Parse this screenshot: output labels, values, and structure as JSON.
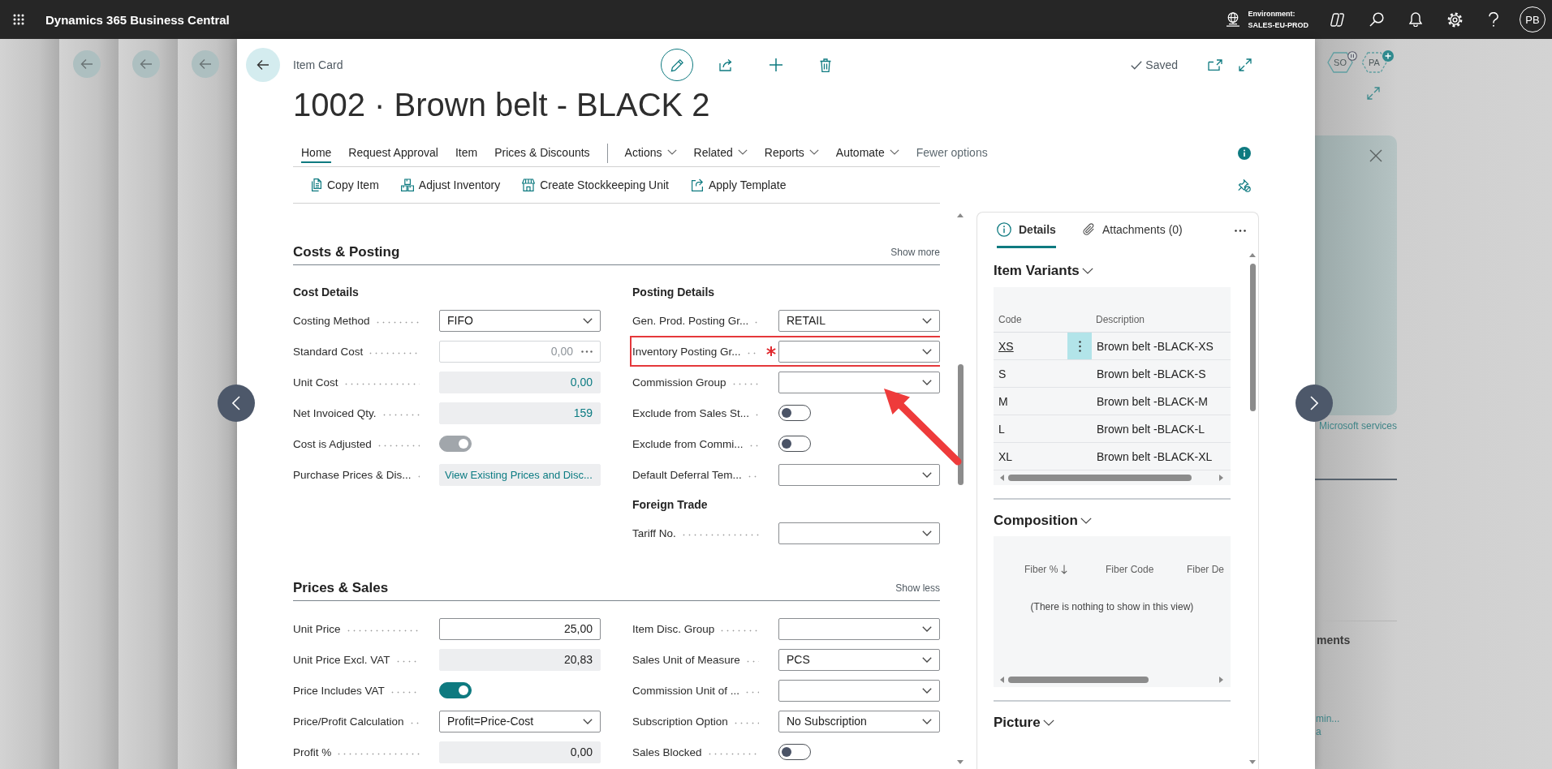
{
  "app_bar": {
    "title": "Dynamics 365 Business Central",
    "environment_label": "Environment:",
    "environment": "SALES-EU-PROD",
    "avatar": "PB"
  },
  "backdrop": {
    "agents": [
      {
        "label": "SO",
        "kind": "paused"
      },
      {
        "label": "PA",
        "kind": "add"
      }
    ],
    "card_link": "Microsoft services",
    "heading": "ments",
    "links": [
      "min...",
      "a"
    ]
  },
  "page": {
    "caption": "Item Card",
    "title": "1002 · Brown belt - BLACK 2",
    "status": "Saved",
    "menu": [
      {
        "label": "Home",
        "kind": "tab",
        "selected": true
      },
      {
        "label": "Request Approval",
        "kind": "tab",
        "selected": false
      },
      {
        "label": "Item",
        "kind": "tab",
        "selected": false
      },
      {
        "label": "Prices & Discounts",
        "kind": "tab",
        "selected": false
      },
      {
        "label": "Actions",
        "kind": "menu",
        "selected": false
      },
      {
        "label": "Related",
        "kind": "menu",
        "selected": false
      },
      {
        "label": "Reports",
        "kind": "menu",
        "selected": false
      },
      {
        "label": "Automate",
        "kind": "menu",
        "selected": false
      },
      {
        "label": "Fewer options",
        "kind": "toggle",
        "selected": false
      }
    ],
    "actions": [
      "Copy Item",
      "Adjust Inventory",
      "Create Stockkeeping Unit",
      "Apply Template"
    ],
    "sections": [
      {
        "title": "Costs & Posting",
        "toggle": "Show more",
        "columns": [
          {
            "groups": [
              {
                "heading": "Cost Details",
                "fields": [
                  {
                    "label": "Costing Method",
                    "kind": "dropdown",
                    "value": "FIFO",
                    "required": false,
                    "disabled": false,
                    "highlighted": false
                  },
                  {
                    "label": "Standard Cost",
                    "kind": "lookup",
                    "value": "0,00",
                    "required": false,
                    "disabled": true,
                    "highlighted": false
                  },
                  {
                    "label": "Unit Cost",
                    "kind": "drilldown",
                    "value": "0,00",
                    "required": false,
                    "disabled": false,
                    "highlighted": false
                  },
                  {
                    "label": "Net Invoiced Qty.",
                    "kind": "drilldown",
                    "value": "159",
                    "required": false,
                    "disabled": false,
                    "highlighted": false
                  },
                  {
                    "label": "Cost is Adjusted",
                    "kind": "toggle",
                    "on": true,
                    "required": false,
                    "disabled": true,
                    "highlighted": false
                  },
                  {
                    "label": "Purchase Prices & Dis...",
                    "kind": "link",
                    "value": "View Existing Prices and Disc...",
                    "required": false,
                    "disabled": false,
                    "highlighted": false
                  }
                ]
              }
            ]
          },
          {
            "groups": [
              {
                "heading": "Posting Details",
                "fields": [
                  {
                    "label": "Gen. Prod. Posting Gr...",
                    "kind": "dropdown",
                    "value": "RETAIL",
                    "required": false,
                    "disabled": false,
                    "highlighted": false
                  },
                  {
                    "label": "Inventory Posting Gr...",
                    "kind": "dropdown",
                    "required": true,
                    "disabled": false,
                    "highlighted": true
                  },
                  {
                    "label": "Commission Group",
                    "kind": "dropdown",
                    "required": false,
                    "disabled": false,
                    "highlighted": false
                  },
                  {
                    "label": "Exclude from Sales St...",
                    "kind": "toggle",
                    "on": false,
                    "required": false,
                    "disabled": false,
                    "highlighted": false
                  },
                  {
                    "label": "Exclude from Commi...",
                    "kind": "toggle",
                    "on": false,
                    "required": false,
                    "disabled": false,
                    "highlighted": false
                  },
                  {
                    "label": "Default Deferral Tem...",
                    "kind": "dropdown",
                    "required": false,
                    "disabled": false,
                    "highlighted": false
                  }
                ]
              },
              {
                "heading": "Foreign Trade",
                "fields": [
                  {
                    "label": "Tariff No.",
                    "kind": "dropdown",
                    "required": false,
                    "disabled": false,
                    "highlighted": false
                  }
                ]
              }
            ]
          }
        ]
      },
      {
        "title": "Prices & Sales",
        "toggle": "Show less",
        "columns": [
          {
            "groups": [
              {
                "fields": [
                  {
                    "label": "Unit Price",
                    "kind": "input",
                    "value": "25,00",
                    "required": false,
                    "disabled": false,
                    "highlighted": false
                  },
                  {
                    "label": "Unit Price Excl. VAT",
                    "kind": "readonly",
                    "value": "20,83",
                    "required": false,
                    "disabled": false,
                    "highlighted": false
                  },
                  {
                    "label": "Price Includes VAT",
                    "kind": "toggle",
                    "on": true,
                    "required": false,
                    "disabled": false,
                    "highlighted": false
                  },
                  {
                    "label": "Price/Profit Calculation",
                    "kind": "dropdown",
                    "value": "Profit=Price-Cost",
                    "required": false,
                    "disabled": false,
                    "highlighted": false
                  },
                  {
                    "label": "Profit %",
                    "kind": "readonly",
                    "value": "0,00",
                    "required": false,
                    "disabled": false,
                    "highlighted": false
                  }
                ]
              }
            ]
          },
          {
            "groups": [
              {
                "fields": [
                  {
                    "label": "Item Disc. Group",
                    "kind": "dropdown",
                    "required": false,
                    "disabled": false,
                    "highlighted": false
                  },
                  {
                    "label": "Sales Unit of Measure",
                    "kind": "dropdown",
                    "value": "PCS",
                    "required": false,
                    "disabled": false,
                    "highlighted": false
                  },
                  {
                    "label": "Commission Unit of ...",
                    "kind": "dropdown",
                    "required": false,
                    "disabled": false,
                    "highlighted": false
                  },
                  {
                    "label": "Subscription Option",
                    "kind": "dropdown",
                    "value": "No Subscription",
                    "required": false,
                    "disabled": false,
                    "highlighted": false
                  },
                  {
                    "label": "Sales Blocked",
                    "kind": "toggle",
                    "on": false,
                    "required": false,
                    "disabled": false,
                    "highlighted": false
                  }
                ]
              }
            ]
          }
        ]
      }
    ]
  },
  "factbox": {
    "tabs": [
      {
        "label": "Details",
        "selected": true
      },
      {
        "label": "Attachments (0)",
        "selected": false
      }
    ],
    "parts": [
      {
        "title": "Item Variants",
        "kind": "list",
        "columns": [
          {
            "label": "Code",
            "sorted": false
          },
          {
            "label": "Description",
            "sorted": false
          }
        ],
        "rows": [
          {
            "code": "XS",
            "description": "Brown belt -BLACK-XS",
            "selected": true
          },
          {
            "code": "S",
            "description": "Brown belt -BLACK-S",
            "selected": false
          },
          {
            "code": "M",
            "description": "Brown belt -BLACK-M",
            "selected": false
          },
          {
            "code": "L",
            "description": "Brown belt -BLACK-L",
            "selected": false
          },
          {
            "code": "XL",
            "description": "Brown belt -BLACK-XL",
            "selected": false
          }
        ]
      },
      {
        "title": "Composition",
        "kind": "empty",
        "columns": [
          {
            "label": "Fiber %",
            "sorted": true
          },
          {
            "label": "Fiber Code",
            "sorted": false
          },
          {
            "label": "Fiber De",
            "sorted": false
          }
        ],
        "empty_text": "(There is nothing to show in this view)"
      },
      {
        "title": "Picture",
        "kind": "picture"
      }
    ]
  }
}
